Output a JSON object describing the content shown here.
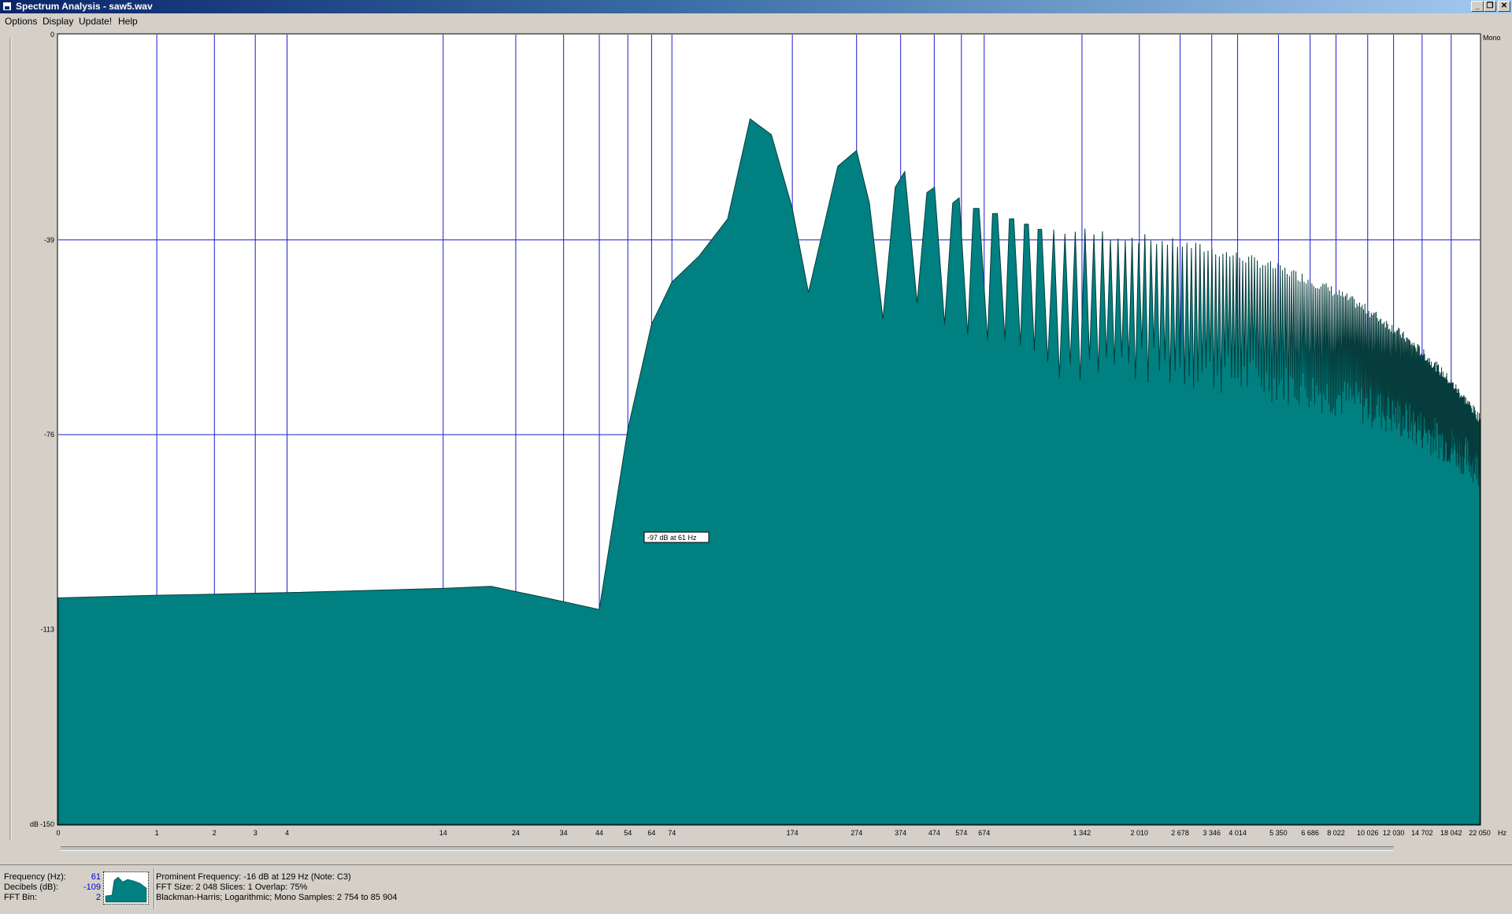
{
  "window": {
    "title": "Spectrum Analysis - saw5.wav",
    "controls": [
      "minimize",
      "restore",
      "close"
    ]
  },
  "menu": {
    "items": [
      {
        "label": "Options",
        "accel": "O"
      },
      {
        "label": "Display",
        "accel": "D"
      },
      {
        "label": "Update!",
        "accel": "U"
      },
      {
        "label": "Help",
        "accel": "H"
      }
    ]
  },
  "chart_data": {
    "type": "area",
    "fill_color": "#008080",
    "grid_color": "#1c1cd0",
    "grid": true,
    "channel_label": "Mono",
    "y_unit_label": "dB",
    "x_unit_label": "Hz",
    "ylim": [
      -150,
      0
    ],
    "y_ticks": [
      {
        "value": 0,
        "label": "0"
      },
      {
        "value": -39,
        "label": "-39"
      },
      {
        "value": -76,
        "label": "-76"
      },
      {
        "value": -113,
        "label": "-113"
      },
      {
        "value": -150,
        "label": "-150"
      }
    ],
    "x_scale": "log",
    "x_ticks": [
      {
        "value": 0,
        "label": "0"
      },
      {
        "value": 1,
        "label": "1"
      },
      {
        "value": 2,
        "label": "2"
      },
      {
        "value": 3,
        "label": "3"
      },
      {
        "value": 4,
        "label": "4"
      },
      {
        "value": 14,
        "label": "14"
      },
      {
        "value": 24,
        "label": "24"
      },
      {
        "value": 34,
        "label": "34"
      },
      {
        "value": 44,
        "label": "44"
      },
      {
        "value": 54,
        "label": "54"
      },
      {
        "value": 64,
        "label": "64"
      },
      {
        "value": 74,
        "label": "74"
      },
      {
        "value": 174,
        "label": "174"
      },
      {
        "value": 274,
        "label": "274"
      },
      {
        "value": 374,
        "label": "374"
      },
      {
        "value": 474,
        "label": "474"
      },
      {
        "value": 574,
        "label": "574"
      },
      {
        "value": 674,
        "label": "674"
      },
      {
        "value": 1342,
        "label": "1 342"
      },
      {
        "value": 2010,
        "label": "2 010"
      },
      {
        "value": 2678,
        "label": "2 678"
      },
      {
        "value": 3346,
        "label": "3 346"
      },
      {
        "value": 4014,
        "label": "4 014"
      },
      {
        "value": 5350,
        "label": "5 350"
      },
      {
        "value": 6686,
        "label": "6 686"
      },
      {
        "value": 8022,
        "label": "8 022"
      },
      {
        "value": 10026,
        "label": "10 026"
      },
      {
        "value": 12030,
        "label": "12 030"
      },
      {
        "value": 14702,
        "label": "14 702"
      },
      {
        "value": 18042,
        "label": "18 042"
      },
      {
        "value": 22050,
        "label": "22 050"
      }
    ],
    "series": [
      {
        "points": [
          [
            0,
            -107
          ],
          [
            1,
            -106.5
          ],
          [
            2,
            -106.3
          ],
          [
            3,
            -106.1
          ],
          [
            4,
            -106
          ],
          [
            14,
            -105.2
          ],
          [
            20,
            -104.8
          ],
          [
            30,
            -107
          ],
          [
            44,
            -109.2
          ],
          [
            54,
            -75
          ],
          [
            64,
            -55
          ],
          [
            74,
            -47
          ],
          [
            90,
            -42
          ],
          [
            110,
            -35
          ],
          [
            129,
            -16
          ],
          [
            150,
            -19
          ],
          [
            174,
            -33
          ],
          [
            195,
            -49
          ],
          [
            240,
            -25
          ],
          [
            274,
            -22
          ],
          [
            300,
            -32
          ],
          [
            330,
            -54
          ],
          [
            360,
            -29
          ],
          [
            385,
            -26
          ],
          [
            420,
            -51
          ],
          [
            450,
            -30
          ],
          [
            475,
            -29
          ],
          [
            510,
            -55
          ],
          [
            540,
            -32
          ],
          [
            565,
            -31
          ],
          [
            600,
            -57
          ],
          [
            625,
            -33
          ],
          [
            650,
            -33
          ],
          [
            690,
            -58
          ],
          [
            715,
            -34
          ],
          [
            740,
            -34
          ],
          [
            780,
            -58
          ],
          [
            805,
            -35
          ],
          [
            830,
            -35
          ],
          [
            870,
            -59
          ],
          [
            895,
            -36
          ],
          [
            920,
            -36
          ],
          [
            960,
            -60
          ],
          [
            985,
            -37
          ],
          [
            1010,
            -37
          ]
        ],
        "dense_harmonics": {
          "from_hz": 1010,
          "to_hz": 22050,
          "peak_db_start": -37,
          "peak_db_end": -73,
          "trough_db_start": -62,
          "trough_db_end": -82
        }
      }
    ],
    "tooltip": {
      "text": "-97 dB at 61 Hz",
      "freq_hz": 61,
      "db": -97
    }
  },
  "status": {
    "frequency_label": "Frequency (Hz):",
    "frequency_value": "61",
    "decibels_label": "Decibels (dB):",
    "decibels_value": "-109",
    "fft_bin_label": "FFT Bin:",
    "fft_bin_value": "2",
    "prominent": "Prominent Frequency: -16 dB at 129 Hz (Note: C3)",
    "fft_info": "FFT Size: 2 048  Slices: 1  Overlap: 75%",
    "window_info": "Blackman-Harris; Logarithmic; Mono  Samples: 2 754 to 85 904"
  }
}
